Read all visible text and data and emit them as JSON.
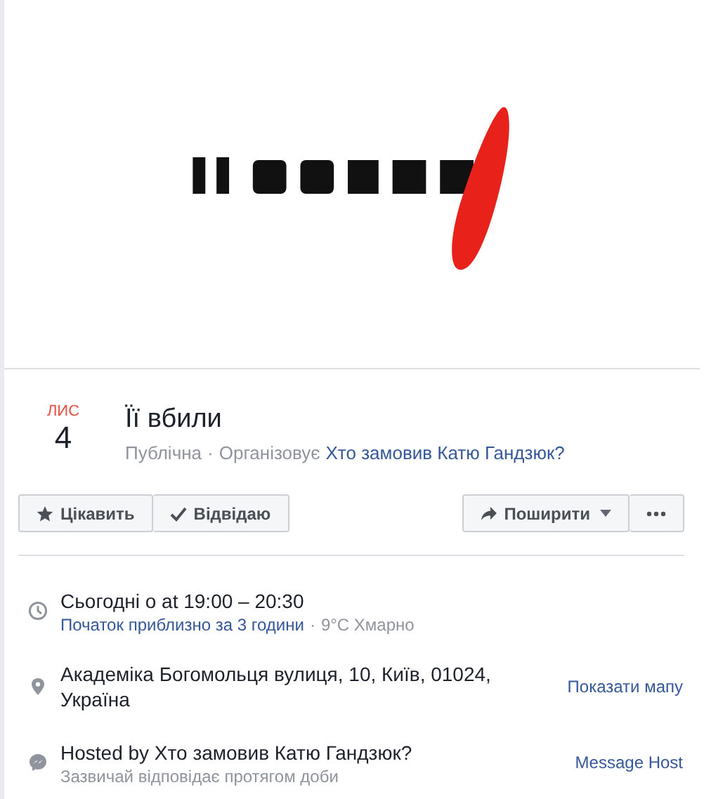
{
  "date": {
    "month": "ЛИС",
    "day": "4"
  },
  "title": "Її вбили",
  "privacy": "Публічна",
  "separator": "·",
  "organizer_label": "Організовує",
  "organizer": "Хто замовив Катю Гандзюк?",
  "actions": [
    {
      "label": "Цікавить",
      "kind": "interested"
    },
    {
      "label": "Відвідаю",
      "kind": "going"
    }
  ],
  "share": {
    "label": "Поширити"
  },
  "details": [
    {
      "kind": "time",
      "main": "Сьогодні о at 19:00 – 20:30",
      "sub_link": "Початок приблизно за 3 години",
      "sub_sep": "·",
      "sub_text": "9°C Хмарно"
    },
    {
      "kind": "location",
      "main": "Академіка Богомольця вулиця, 10, Київ, 01024, Україна",
      "action": "Показати мапу"
    },
    {
      "kind": "host",
      "main": "Hosted by Хто замовив Катю Гандзюк?",
      "sub_text": "Зазвичай відповідає протягом доби",
      "action": "Message Host"
    }
  ]
}
